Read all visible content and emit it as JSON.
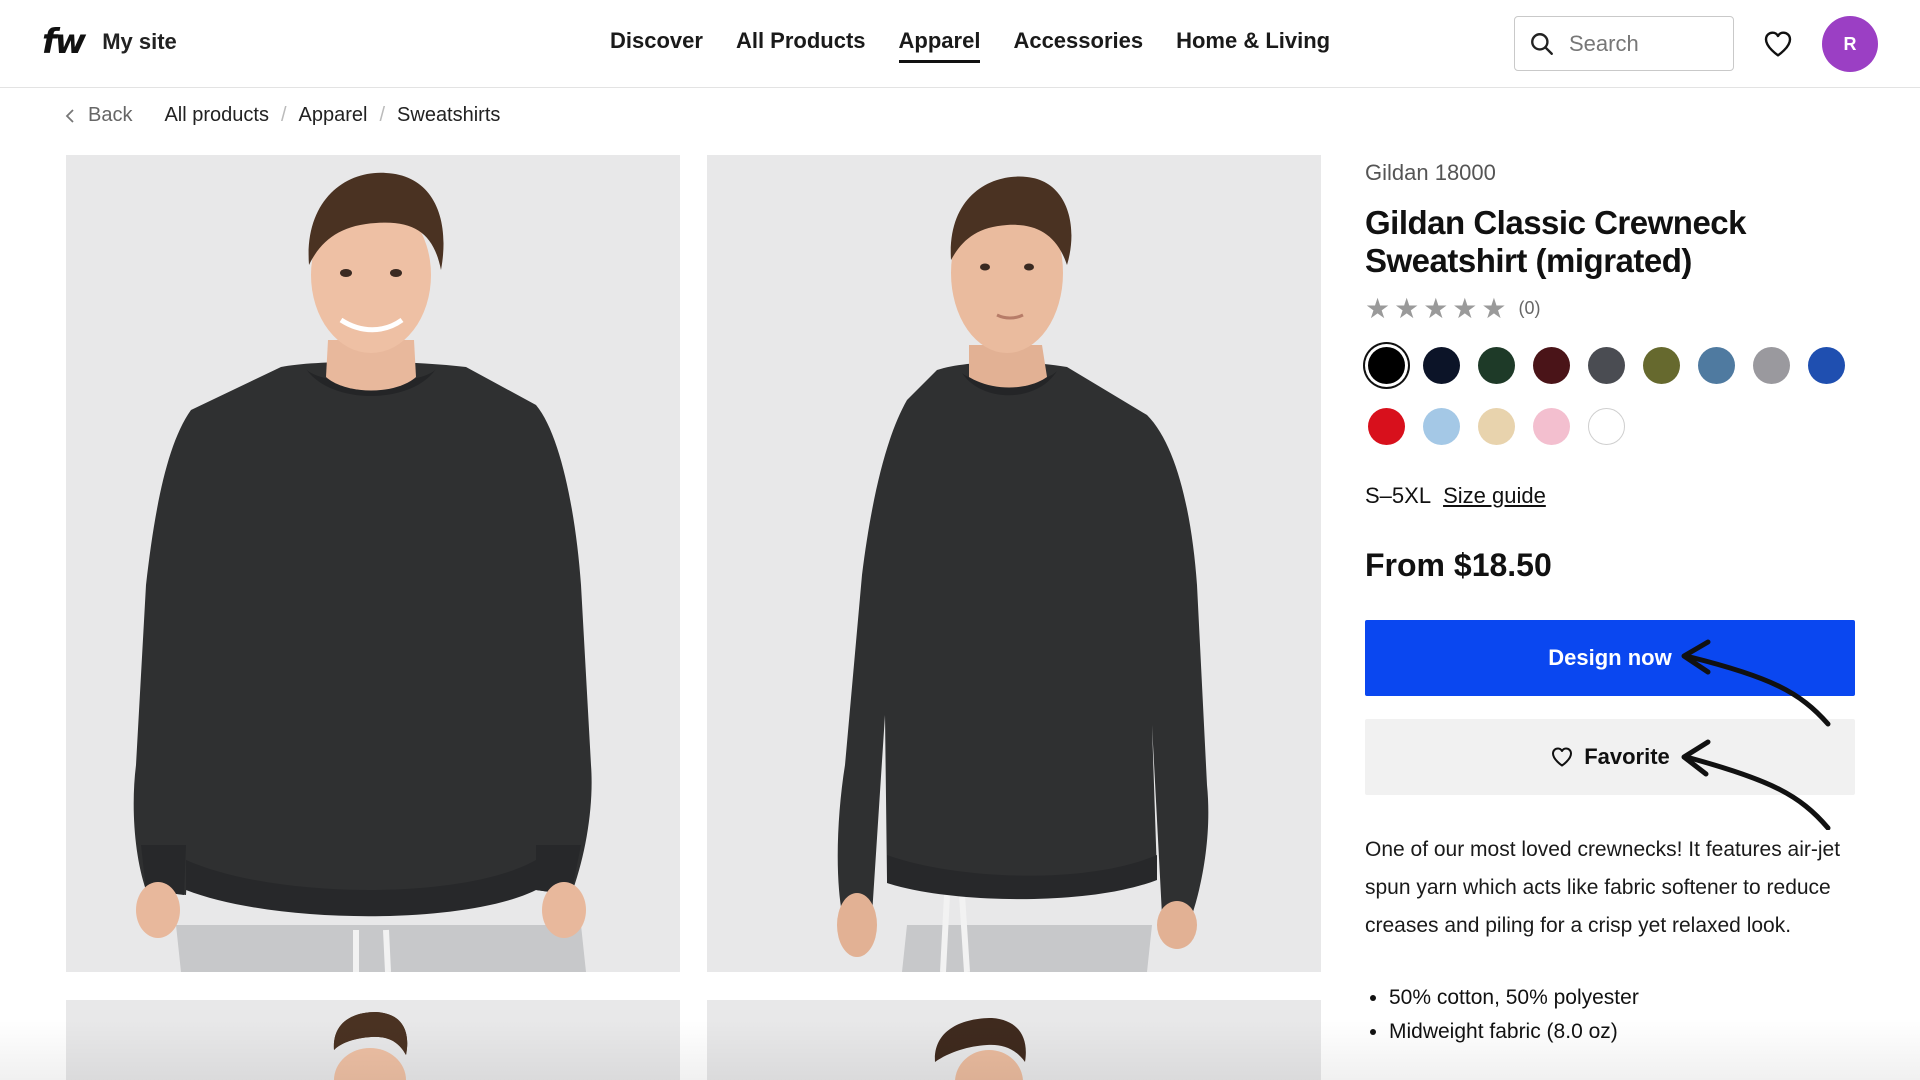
{
  "header": {
    "logo": "fw",
    "site_name": "My site",
    "nav": [
      "Discover",
      "All Products",
      "Apparel",
      "Accessories",
      "Home & Living"
    ],
    "active_nav": "Apparel",
    "search_placeholder": "Search",
    "avatar_initial": "R",
    "avatar_color": "#9b3fc4"
  },
  "breadcrumb": {
    "back_label": "Back",
    "items": [
      "All products",
      "Apparel",
      "Sweatshirts"
    ]
  },
  "product": {
    "sku": "Gildan 18000",
    "title": "Gildan Classic Crewneck Sweatshirt (migrated)",
    "stars": "★★★★★",
    "rating_count": "(0)",
    "swatch_colors": [
      "#000000",
      "#0c1428",
      "#1e3a28",
      "#4a1418",
      "#4a4c52",
      "#66692e",
      "#4f7aa0",
      "#9a999e",
      "#1f4fb0",
      "#d8101c",
      "#a4c8e6",
      "#e8d3ad",
      "#f3bfcf",
      "#ffffff"
    ],
    "selected_swatch": 0,
    "size_range": "S–5XL",
    "size_guide_label": "Size guide",
    "price": "From $18.50",
    "primary_cta": "Design now",
    "secondary_cta": "Favorite",
    "description": "One of our most loved crewnecks! It features air-jet spun yarn which acts like fabric softener to reduce creases and piling for a crisp yet relaxed look.",
    "features": [
      "50% cotton, 50% polyester",
      "Midweight fabric (8.0 oz)"
    ]
  },
  "colors": {
    "primary_button": "#0a47f0",
    "secondary_button": "#f1f1f1",
    "photo_background": "#e8e8e9",
    "garment": "#2f3031"
  }
}
